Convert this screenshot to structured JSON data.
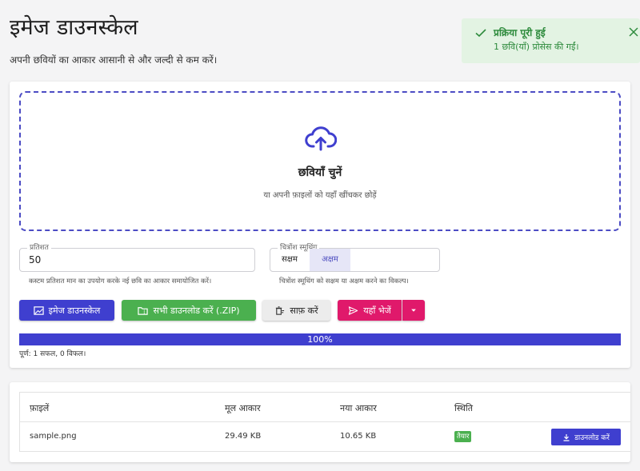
{
  "header": {
    "title": "इमेज डाउनस्केल",
    "subtitle": "अपनी छवियों का आकार आसानी से और जल्दी से कम करें।"
  },
  "toast": {
    "title": "प्रक्रिया पूरी हुई",
    "message": "1 छवि(याँ) प्रोसेस की गईं।",
    "color": "#2e8b3d",
    "background": "#e3f3e3"
  },
  "dropzone": {
    "title": "छवियाँ चुनें",
    "hint": "या अपनी फ़ाइलों को यहाँ खींचकर छोड़ें",
    "icon": "cloud-upload-icon"
  },
  "options": {
    "percentage": {
      "label": "प्रतिशत",
      "value": "50",
      "helper": "कस्टम प्रतिशत मान का उपयोग करके नई छवि का आकार समायोजित करें।"
    },
    "smoothing": {
      "label": "चित्रोंश स्मूथिंग",
      "on_label": "सक्षम",
      "off_label": "अक्षम",
      "selected": "अक्षम",
      "helper": "चित्रोंश स्मूथिंग को सक्षम या अक्षम करने का विकल्प।"
    }
  },
  "actions": {
    "downscale_label": "इमेज डाउनस्केल",
    "download_zip_label": "सभी डाउनलोड करें (.ZIP)",
    "clear_label": "साफ़ करें",
    "send_label": "यहाँ भेजें"
  },
  "progress": {
    "percent": 100,
    "label": "100%",
    "summary": "पूर्ण: 1 सफल, 0 विफल।"
  },
  "files": {
    "columns": [
      "फ़ाइलें",
      "मूल आकार",
      "नया आकार",
      "स्थिति"
    ],
    "rows": [
      {
        "name": "sample.png",
        "original_size": "29.49 KB",
        "new_size": "10.65 KB",
        "status": "तैयार",
        "download_label": "डाउनलोड करें"
      }
    ]
  },
  "colors": {
    "primary": "#3f3fcf",
    "success": "#4bb04f",
    "pink": "#e0196b"
  }
}
